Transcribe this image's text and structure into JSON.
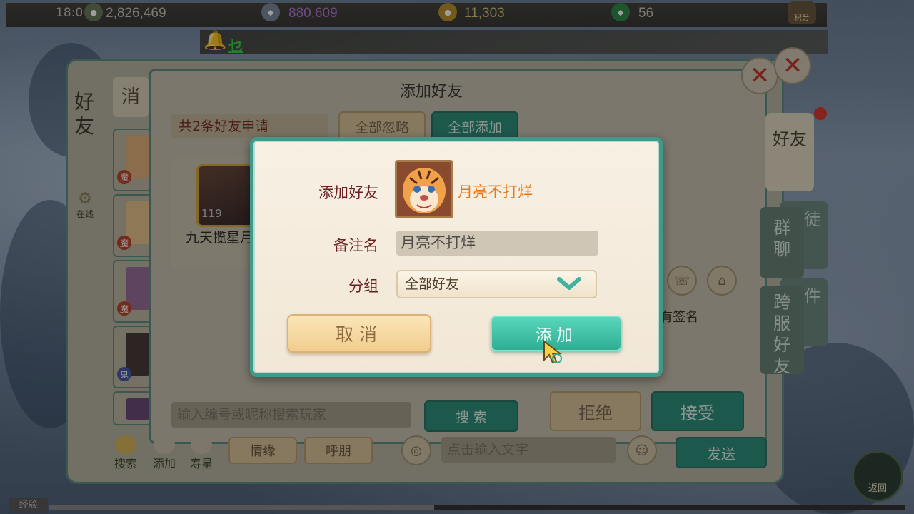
{
  "status_bar": {
    "time": "18:0"
  },
  "resources": [
    {
      "name": "silver",
      "value": "2,826,469",
      "color": "#c9c2b2",
      "icon": "silver-coin-icon"
    },
    {
      "name": "bound-silver",
      "value": "880,609",
      "color": "#b07ad8",
      "icon": "silver-ingot-icon"
    },
    {
      "name": "gold",
      "value": "11,303",
      "color": "#d9c27a",
      "icon": "gold-coin-icon"
    },
    {
      "name": "jade",
      "value": "56",
      "color": "#c9c2b2",
      "icon": "jade-icon"
    }
  ],
  "score_button": {
    "label": "积分"
  },
  "chat": {
    "text": "乜"
  },
  "friend_panel": {
    "title": "好友",
    "online_label": "在线",
    "dialog_title": "添加好友",
    "request_count": "共2条好友申请",
    "ignore_all": "全部忽略",
    "add_all": "全部添加",
    "left_tab": "消",
    "slot_badges": [
      "魔",
      "魔",
      "魔",
      "鬼"
    ],
    "request": {
      "level": "119",
      "name": "九天揽星月"
    },
    "search_placeholder": "输入编号或昵称搜索玩家",
    "search_button": "搜 索",
    "reject": "拒绝",
    "accept": "接受",
    "bottom_nav": [
      "搜索",
      "添加",
      "寿星"
    ],
    "chip_love": "情缘",
    "chip_call": "呼朋",
    "input_hint": "点击输入文字",
    "send": "发送",
    "signature": "有签名",
    "side_tabs": [
      "好友",
      "群聊",
      "跨服好友"
    ],
    "side_tabs_back": [
      "师徒",
      "邮件"
    ],
    "back": "返回"
  },
  "exp": {
    "label": "经验",
    "fill": 0.45
  },
  "modal": {
    "add_friend_label": "添加好友",
    "friend_name": "月亮不打烊",
    "remark_label": "备注名",
    "remark_value": "月亮不打烊",
    "group_label": "分组",
    "group_value": "全部好友",
    "cancel": "取消",
    "confirm": "添加"
  },
  "colors": {
    "accent": "#3f9a89",
    "cancel": "#f1cd8d",
    "confirm": "#2fae94",
    "name": "#e57a1e",
    "label": "#6b1f1f"
  }
}
